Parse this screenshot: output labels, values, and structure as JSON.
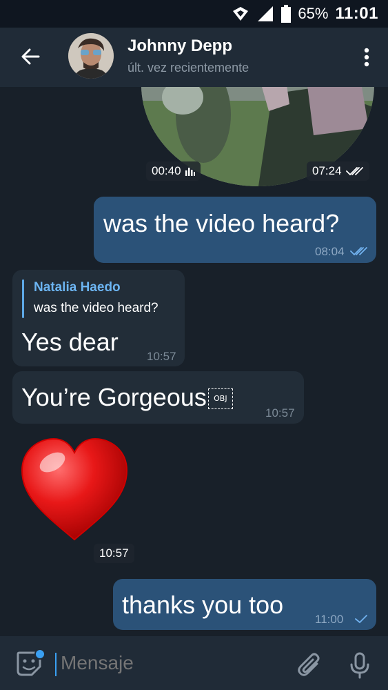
{
  "status_bar": {
    "battery_percent": "65%",
    "time": "11:01",
    "icons": [
      "vpn-icon",
      "signal-icon",
      "battery-icon"
    ]
  },
  "header": {
    "title": "Johnny Depp",
    "subtitle": "últ. vez recientemente",
    "icons": [
      "back-arrow-icon",
      "more-vert-icon"
    ]
  },
  "chat": {
    "video_message": {
      "duration": "00:40",
      "time": "07:24"
    },
    "messages": [
      {
        "direction": "out",
        "text": "was the video heard?",
        "time": "08:04",
        "status": "read"
      },
      {
        "direction": "in",
        "reply_name": "Natalia Haedo",
        "reply_text": "was the video heard?",
        "text": "Yes dear",
        "time": "10:57"
      },
      {
        "direction": "in",
        "text": "You’re Gorgeous",
        "obj_placeholder": "OBJ",
        "time": "10:57"
      },
      {
        "direction": "in",
        "sticker": "red-heart",
        "time": "10:57"
      },
      {
        "direction": "out",
        "text": "thanks you too",
        "time": "11:00",
        "status": "sent"
      }
    ]
  },
  "composer": {
    "placeholder": "Mensaje",
    "icons": [
      "sticker-icon",
      "attach-icon",
      "mic-icon"
    ]
  },
  "colors": {
    "background": "#182029",
    "header": "#202b37",
    "outgoing_bubble": "#2b5278",
    "incoming_bubble": "#222d38",
    "accent": "#3aa0f3"
  }
}
